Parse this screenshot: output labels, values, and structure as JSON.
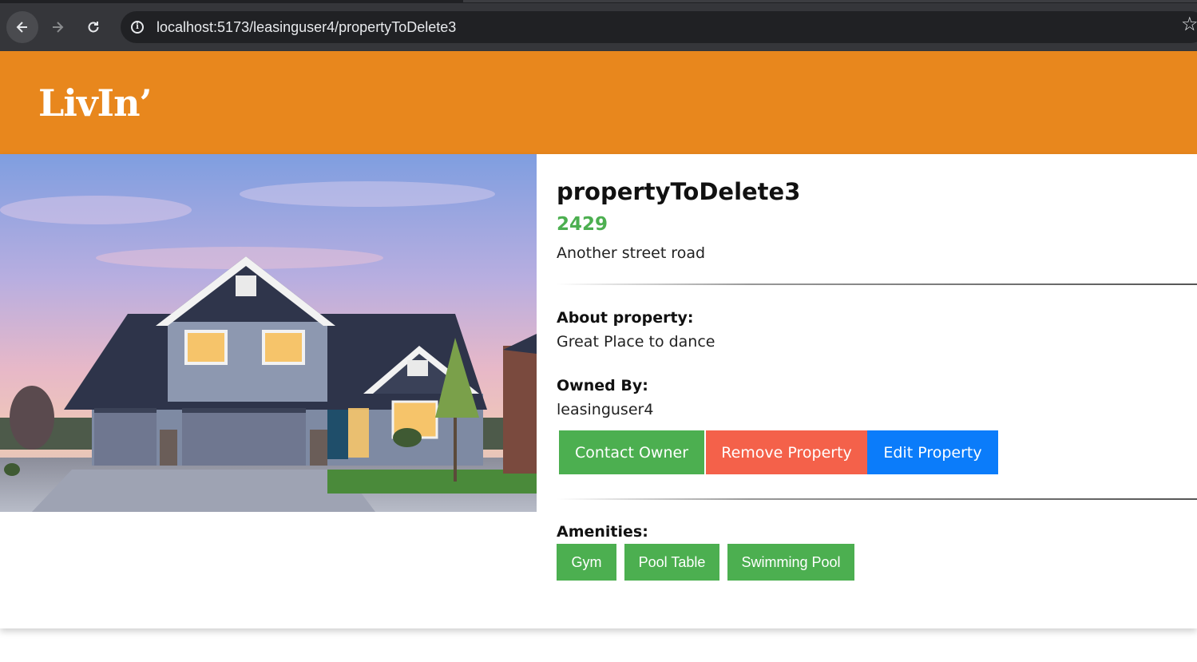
{
  "browser": {
    "url": "localhost:5173/leasinguser4/propertyToDelete3"
  },
  "site": {
    "logo": "LivIn’",
    "accent_color": "#e8871d"
  },
  "property": {
    "name": "propertyToDelete3",
    "price": "2429",
    "address": "Another street road",
    "about_label": "About property:",
    "about_text": "Great Place to dance",
    "owner_label": "Owned By:",
    "owner": "leasinguser4",
    "amenities_label": "Amenities:",
    "amenities": [
      "Gym",
      "Pool Table",
      "Swimming Pool"
    ]
  },
  "actions": {
    "contact": "Contact Owner",
    "remove": "Remove Property",
    "edit": "Edit Property"
  },
  "colors": {
    "green": "#4caf50",
    "red": "#f4614a",
    "blue": "#0b7cfa"
  }
}
